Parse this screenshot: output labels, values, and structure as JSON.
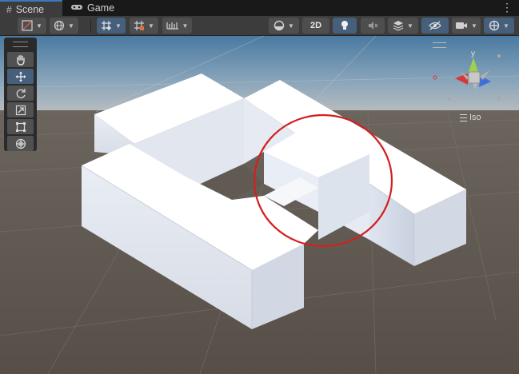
{
  "tabs": [
    {
      "label": "Scene",
      "icon": "hash-icon",
      "active": true
    },
    {
      "label": "Game",
      "icon": "gamepad-icon",
      "active": false
    }
  ],
  "tab_menu_glyph": "⋮",
  "toolbar": {
    "mode_2d_label": "2D",
    "left_buttons": [
      "shading-mode",
      "draw-mode",
      "grid-snap",
      "grid-visibility",
      "increment-snap"
    ],
    "right_buttons": [
      "shading-sphere",
      "2d-toggle",
      "lighting",
      "audio",
      "effects",
      "hidden-objects",
      "camera",
      "gizmos"
    ]
  },
  "tools": [
    "view-tool",
    "move-tool",
    "rotate-tool",
    "scale-tool",
    "rect-tool",
    "transform-tool"
  ],
  "active_tool": "move-tool",
  "gizmo": {
    "y_label": "y",
    "projection_label": "Iso",
    "colors": {
      "y": "#9ed14d",
      "x": "#d93636",
      "z": "#3c6fd7",
      "center": "#c8c8c8"
    }
  },
  "annotation": {
    "color": "#d41f1f",
    "shape": "circle"
  },
  "colors": {
    "sky": "#4e7a9e",
    "ground": "#5d5750",
    "block_top": "#ffffff",
    "block_side": "#dde3ee",
    "accent": "#46607c"
  }
}
